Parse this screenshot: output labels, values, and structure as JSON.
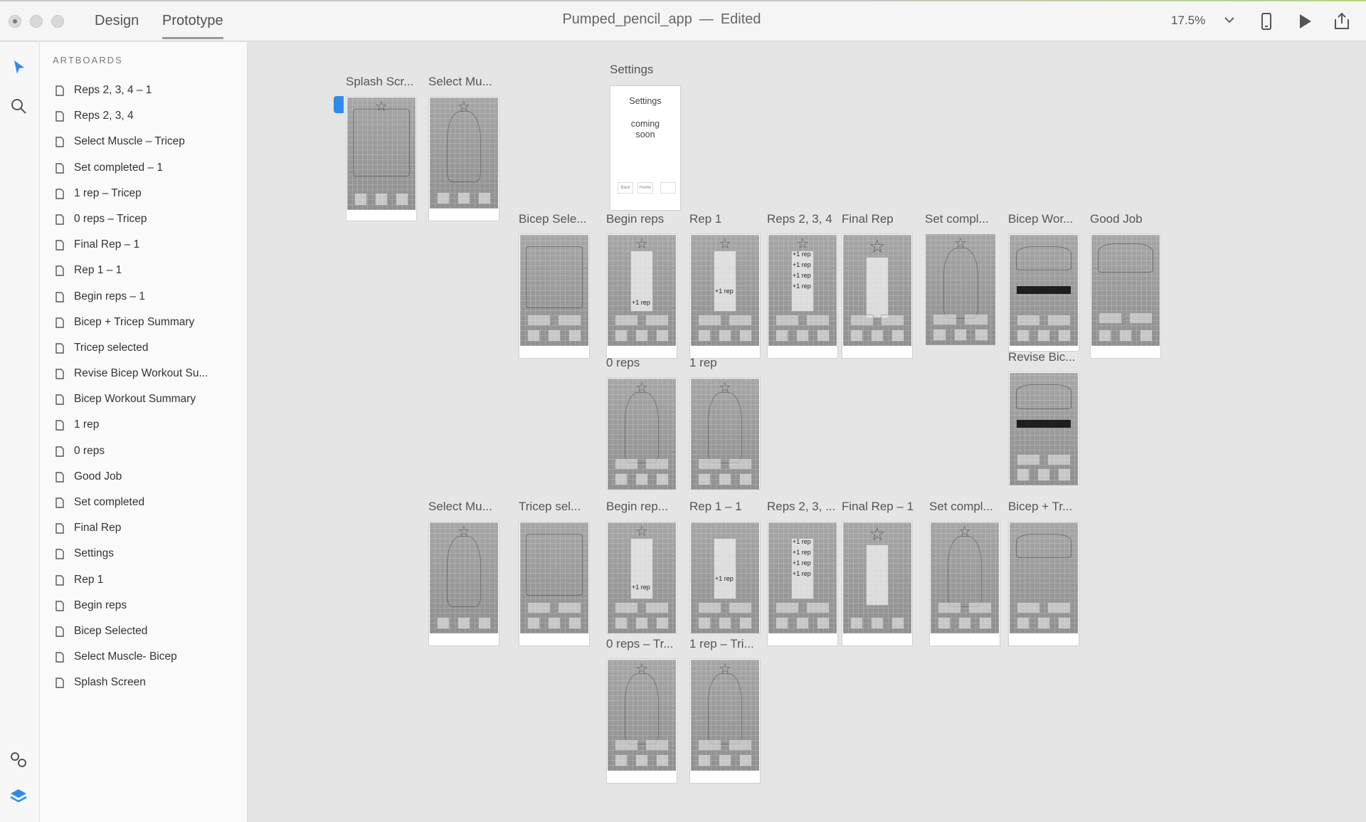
{
  "titlebar": {
    "tabs": [
      {
        "label": "Design",
        "active": false
      },
      {
        "label": "Prototype",
        "active": true
      }
    ],
    "document_name": "Pumped_pencil_app",
    "separator": "—",
    "document_status": "Edited",
    "zoom": "17.5%"
  },
  "rail": {
    "tools": [
      "select-tool",
      "search-tool",
      "symbols-tool",
      "layers-tool"
    ]
  },
  "panel": {
    "heading": "ARTBOARDS",
    "items": [
      "Reps 2, 3, 4 – 1",
      "Reps 2, 3, 4",
      "Select Muscle – Tricep",
      "Set completed – 1",
      "1 rep – Tricep",
      "0 reps – Tricep",
      "Final Rep – 1",
      "Rep 1 – 1",
      "Begin reps – 1",
      "Bicep + Tricep Summary",
      "Tricep selected",
      "Revise Bicep Workout Su...",
      "Bicep Workout Summary",
      "1 rep",
      "0 reps",
      "Good Job",
      "Set completed",
      "Final Rep",
      "Settings",
      "Rep 1",
      "Begin reps",
      "Bicep Selected",
      "Select Muscle- Bicep",
      "Splash Screen"
    ]
  },
  "canvas": {
    "settings_artboard": {
      "label": "Settings",
      "title": "Settings",
      "body": "coming soon",
      "back_label": "Back",
      "home_label": "Home"
    },
    "artboard_labels": {
      "splash": "Splash Scr...",
      "select_muscle_top": "Select Mu...",
      "bicep_selected": "Bicep Sele...",
      "begin_reps": "Begin reps",
      "rep1": "Rep 1",
      "reps234": "Reps 2, 3, 4",
      "final_rep": "Final Rep",
      "set_completed": "Set compl...",
      "bicep_workout": "Bicep Wor...",
      "good_job": "Good Job",
      "zero_reps": "0 reps",
      "one_rep": "1 rep",
      "revise_bicep": "Revise Bic...",
      "select_muscle_bottom": "Select Mu...",
      "tricep_selected": "Tricep sel...",
      "begin_reps_1": "Begin rep...",
      "rep1_1": "Rep 1 – 1",
      "reps234_1": "Reps 2, 3, ...",
      "final_rep_1": "Final Rep – 1",
      "set_completed_1": "Set compl...",
      "bicep_tricep": "Bicep + Tr...",
      "zero_reps_tricep": "0 reps – Tr...",
      "one_rep_tricep": "1 rep – Tri..."
    },
    "sketch_texts": {
      "plus_one_rep": "+1 rep"
    }
  }
}
